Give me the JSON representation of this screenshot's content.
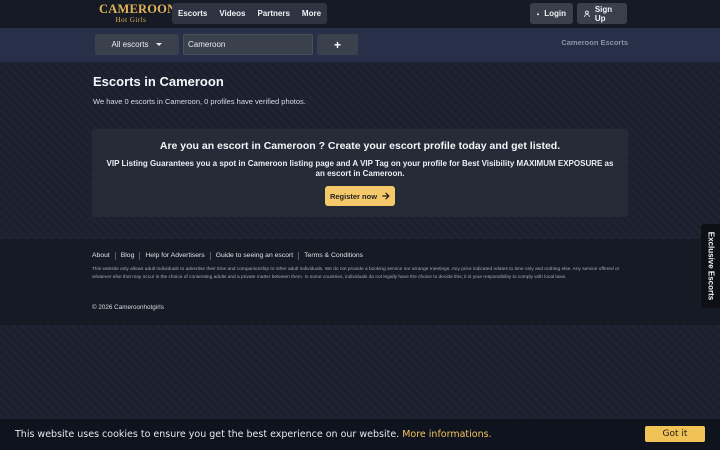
{
  "header": {
    "logo_main": "CAMEROON",
    "logo_sub": "Hot Girls",
    "nav": [
      "Escorts",
      "Videos",
      "Partners",
      "More"
    ],
    "login_label": "Login",
    "signup_label": "Sign Up",
    "login_icon": "lock-icon",
    "signup_icon": "user-icon"
  },
  "search": {
    "category_selected": "All escorts",
    "location_value": "Cameroon",
    "add_label": "+",
    "breadcrumb": "Cameroon Escorts"
  },
  "main": {
    "title": "Escorts in Cameroon",
    "summary": "We have 0 escorts in Cameroon, 0 profiles have verified photos."
  },
  "promo": {
    "heading": "Are you an escort in Cameroon ? Create your escort profile today and get listed.",
    "text": "VIP Listing Guarantees you a spot in Cameroon listing page and A VIP Tag on your profile for Best Visibility MAXIMUM EXPOSURE as an escort in Cameroon.",
    "button_label": "Register now",
    "button_icon": "arrow-right-icon"
  },
  "footer": {
    "links": [
      "About",
      "Blog",
      "Help for Advertisers",
      "Guide to seeing an escort",
      "Terms & Conditions"
    ],
    "disclaimer": "This website only allows adult individuals to advertise their time and companionship to other adult individuals. We do not provide a booking service nor arrange meetings. Any price indicated relates to time only and nothing else. Any service offered or whatever else that may occur is the choice of consenting adults and a private matter between them. In some countries, individuals do not legally have the choice to decide this; it is your responsibility to comply with local laws.",
    "copyright": "© 2026 Cameroonhotgirls"
  },
  "side_tab": {
    "label": "Exclusive Escorts"
  },
  "cookie": {
    "message": "This website uses cookies to ensure you get the best experience on our website.",
    "link_label": "More informations.",
    "button_label": "Got it"
  },
  "colors": {
    "accent": "#f5c86a",
    "logo": "#e0b35a",
    "header_bg": "#161a24",
    "search_bg": "#273048",
    "page_bg": "#1c2130"
  }
}
